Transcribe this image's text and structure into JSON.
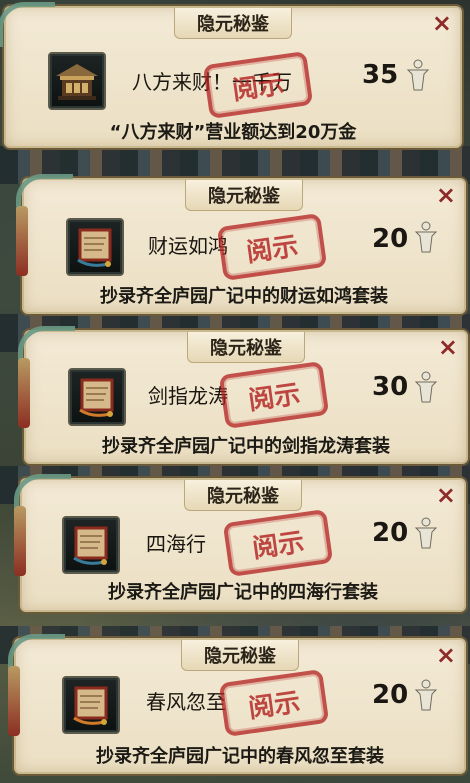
{
  "cards": [
    {
      "title": "隐元秘鉴",
      "item_name": "八方来财！一千万",
      "reward": "35",
      "description": "“八方来财”营业额达到20万金",
      "stamp": "阅示",
      "item_icon": "pavilion-icon",
      "close": "×"
    },
    {
      "title": "隐元秘鉴",
      "item_name": "财运如鸿",
      "reward": "20",
      "description": "抄录齐全庐园广记中的财运如鸿套装",
      "stamp": "阅示",
      "item_icon": "scroll-icon",
      "close": "×"
    },
    {
      "title": "隐元秘鉴",
      "item_name": "剑指龙涛",
      "reward": "30",
      "description": "抄录齐全庐园广记中的剑指龙涛套装",
      "stamp": "阅示",
      "item_icon": "scroll-icon",
      "close": "×"
    },
    {
      "title": "隐元秘鉴",
      "item_name": "四海行",
      "reward": "20",
      "description": "抄录齐全庐园广记中的四海行套装",
      "stamp": "阅示",
      "item_icon": "scroll-icon",
      "close": "×"
    },
    {
      "title": "隐元秘鉴",
      "item_name": "春风忽至",
      "reward": "20",
      "description": "抄录齐全庐园广记中的春风忽至套装",
      "stamp": "阅示",
      "item_icon": "scroll-icon",
      "close": "×"
    }
  ],
  "reward_icon": "figure-icon",
  "colors": {
    "parchment": "#efe4ca",
    "stamp_red": "#b21e1e",
    "close_red": "#8e2a2a",
    "jade": "#6a9a86"
  }
}
